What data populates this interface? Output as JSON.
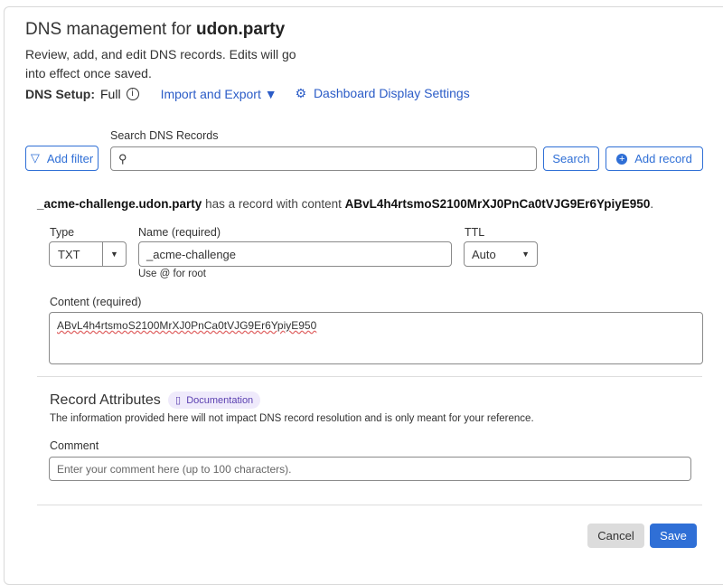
{
  "header": {
    "title_prefix": "DNS management for ",
    "domain": "udon.party",
    "description": "Review, add, and edit DNS records. Edits will go into effect once saved.",
    "setup_label": "DNS Setup:",
    "setup_value": "Full",
    "import_export": "Import and Export",
    "dashboard_settings": "Dashboard Display Settings"
  },
  "toolbar": {
    "add_filter": "Add filter",
    "search_label": "Search DNS Records",
    "search_value": "",
    "search_button": "Search",
    "add_record": "Add record"
  },
  "summary": {
    "name": "_acme-challenge.udon.party",
    "middle": " has a record with content ",
    "content": "ABvL4h4rtsmoS2100MrXJ0PnCa0tVJG9Er6YpiyE950",
    "end": "."
  },
  "form": {
    "type_label": "Type",
    "type_value": "TXT",
    "name_label": "Name (required)",
    "name_value": "_acme-challenge",
    "name_hint": "Use @ for root",
    "ttl_label": "TTL",
    "ttl_value": "Auto",
    "content_label": "Content (required)",
    "content_value": "ABvL4h4rtsmoS2100MrXJ0PnCa0tVJG9Er6YpiyE950"
  },
  "attributes": {
    "title": "Record Attributes",
    "doc_badge": "Documentation",
    "info": "The information provided here will not impact DNS record resolution and is only meant for your reference.",
    "comment_label": "Comment",
    "comment_placeholder": "Enter your comment here (up to 100 characters)."
  },
  "actions": {
    "cancel": "Cancel",
    "save": "Save"
  }
}
